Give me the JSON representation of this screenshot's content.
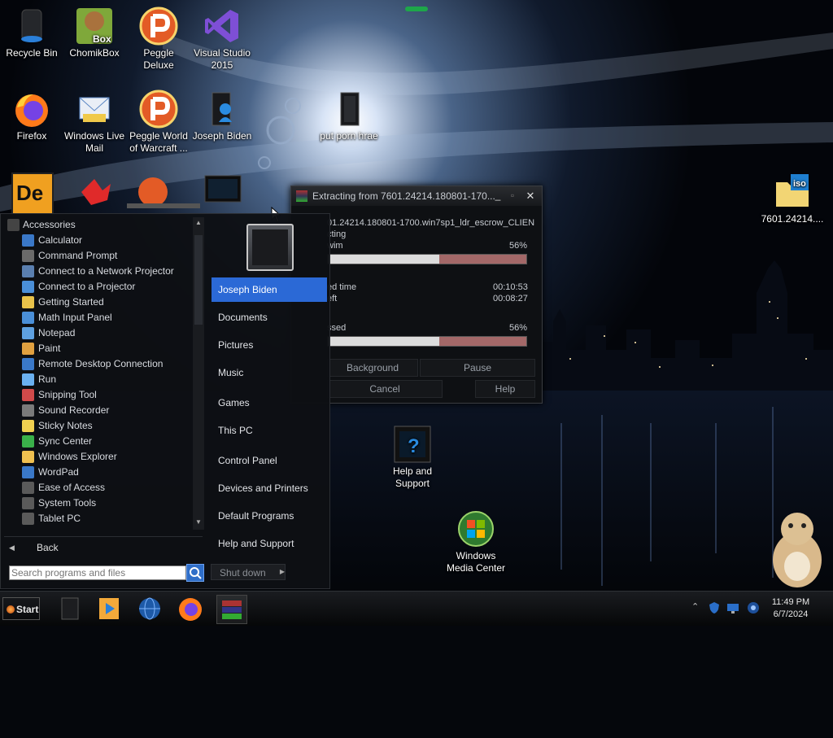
{
  "desktop": {
    "icons": [
      {
        "label": "Recycle Bin"
      },
      {
        "label": "ChomikBox"
      },
      {
        "label": "Peggle Deluxe"
      },
      {
        "label": "Visual Studio 2015"
      },
      {
        "label": "Firefox"
      },
      {
        "label": "Windows Live Mail"
      },
      {
        "label": "Peggle World of Warcraft ..."
      },
      {
        "label": "Joseph Biden"
      },
      {
        "label": "put porn hrae"
      },
      {
        "label": "7601.24214...."
      },
      {
        "label": "Help and Support"
      },
      {
        "label": "Windows Media Center"
      }
    ],
    "chomik_badge": "Box",
    "iso_badge": "iso"
  },
  "start_menu": {
    "programs": [
      {
        "label": "Accessories",
        "folder": true
      },
      {
        "label": "Calculator"
      },
      {
        "label": "Command Prompt"
      },
      {
        "label": "Connect to a Network Projector"
      },
      {
        "label": "Connect to a Projector"
      },
      {
        "label": "Getting Started"
      },
      {
        "label": "Math Input Panel"
      },
      {
        "label": "Notepad"
      },
      {
        "label": "Paint"
      },
      {
        "label": "Remote Desktop Connection"
      },
      {
        "label": "Run"
      },
      {
        "label": "Snipping Tool"
      },
      {
        "label": "Sound Recorder"
      },
      {
        "label": "Sticky Notes"
      },
      {
        "label": "Sync Center"
      },
      {
        "label": "Windows Explorer"
      },
      {
        "label": "WordPad"
      },
      {
        "label": "Ease of Access"
      },
      {
        "label": "System Tools"
      },
      {
        "label": "Tablet PC"
      }
    ],
    "back_label": "Back",
    "search_placeholder": "Search programs and files",
    "right_items": [
      {
        "label": "Joseph Biden",
        "selected": true
      },
      {
        "label": "Documents"
      },
      {
        "label": "Pictures"
      },
      {
        "label": "Music"
      },
      {
        "label": "Games"
      },
      {
        "label": "This PC"
      },
      {
        "label": "Control Panel"
      },
      {
        "label": "Devices and Printers"
      },
      {
        "label": "Default Programs"
      },
      {
        "label": "Help and Support"
      }
    ],
    "shutdown_label": "Shut down"
  },
  "extract_dialog": {
    "title": "Extracting from 7601.24214.180801-170...",
    "minimize": "_",
    "close": "✕",
    "filename": "01.24214.180801-1700.win7sp1_ldr_escrow_CLIEN",
    "status_line": "cting",
    "file_label": "wim",
    "file_percent": "56%",
    "file_progress": 0.56,
    "elapsed_label": "ed time",
    "elapsed_value": "00:10:53",
    "left_label": "eft",
    "left_value": "00:08:27",
    "processed_label": "ssed",
    "processed_percent": "56%",
    "processed_progress": 0.56,
    "buttons": {
      "background": "Background",
      "pause": "Pause",
      "cancel": "Cancel",
      "help": "Help"
    }
  },
  "taskbar": {
    "start_label": "Start",
    "clock_time": "11:49 PM",
    "clock_date": "6/7/2024"
  },
  "colors": {
    "selection": "#2b69d6",
    "progress_fill": "#dcdcdc",
    "progress_remaining": "#a36868"
  }
}
